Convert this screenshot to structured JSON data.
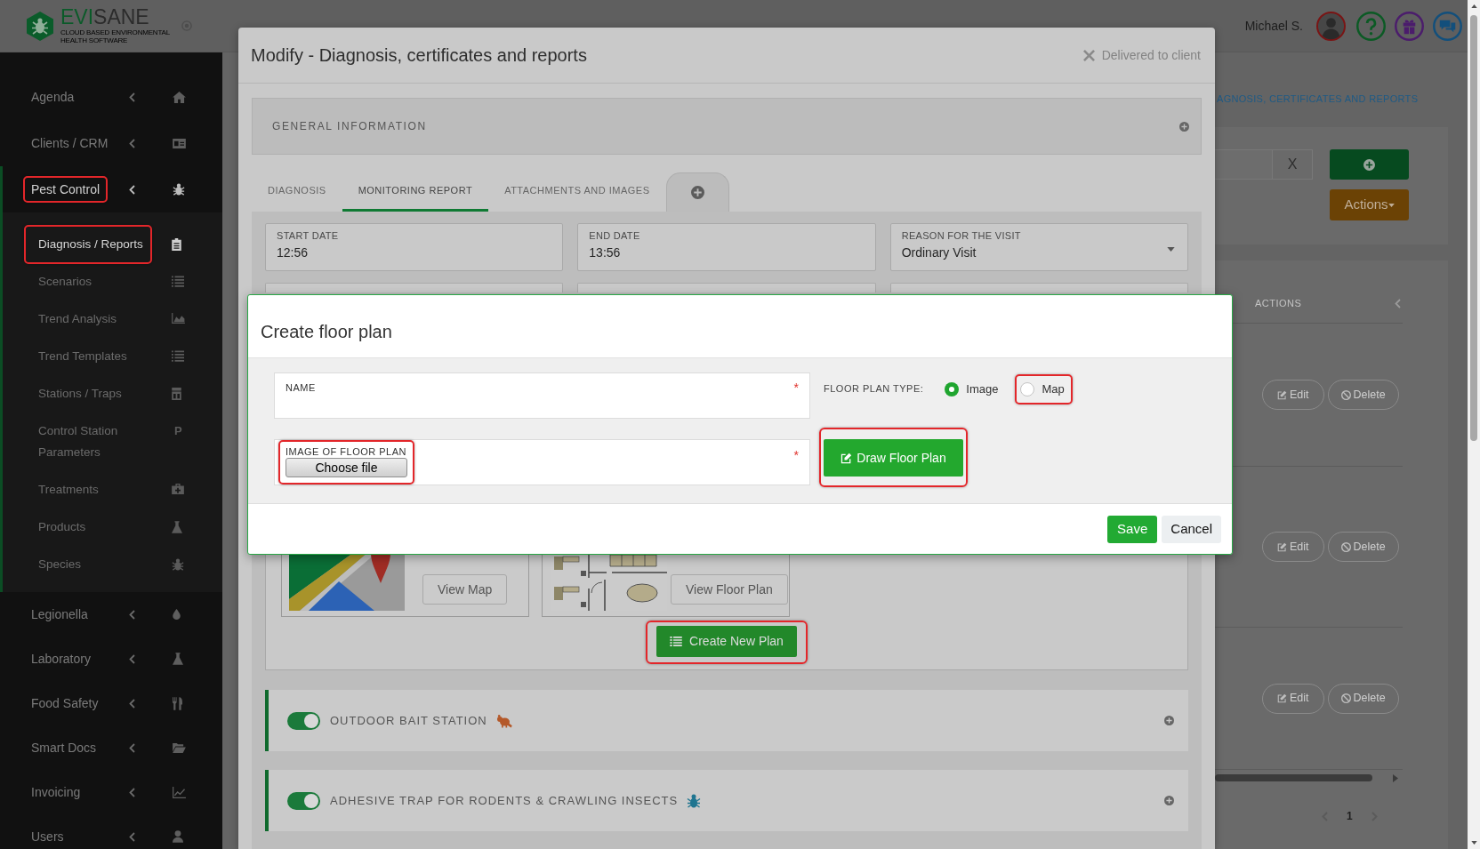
{
  "header": {
    "logo": "EVISANE",
    "tagline": "CLOUD BASED ENVIRONMENTAL HEALTH SOFTWARE",
    "user_name": "Michael S."
  },
  "sidebar": {
    "items": [
      {
        "label": "Agenda",
        "expanded": false,
        "highlighted": false
      },
      {
        "label": "Clients / CRM",
        "expanded": false,
        "highlighted": false
      },
      {
        "label": "Pest Control",
        "expanded": true,
        "highlighted": true,
        "children": [
          {
            "label": "Diagnosis / Reports",
            "selected": true,
            "highlighted": true
          },
          {
            "label": "Scenarios",
            "selected": false,
            "highlighted": false
          },
          {
            "label": "Trend Analysis",
            "selected": false,
            "highlighted": false
          },
          {
            "label": "Trend Templates",
            "selected": false,
            "highlighted": false
          },
          {
            "label": "Stations / Traps",
            "selected": false,
            "highlighted": false
          },
          {
            "label": "Control Station Parameters",
            "selected": false,
            "highlighted": false,
            "icon_letter": "P"
          },
          {
            "label": "Treatments",
            "selected": false,
            "highlighted": false
          },
          {
            "label": "Products",
            "selected": false,
            "highlighted": false
          },
          {
            "label": "Species",
            "selected": false,
            "highlighted": false
          }
        ]
      },
      {
        "label": "Legionella",
        "expanded": false,
        "highlighted": false
      },
      {
        "label": "Laboratory",
        "expanded": false,
        "highlighted": false
      },
      {
        "label": "Food Safety",
        "expanded": false,
        "highlighted": false
      },
      {
        "label": "Smart Docs",
        "expanded": false,
        "highlighted": false
      },
      {
        "label": "Invoicing",
        "expanded": false,
        "highlighted": false
      },
      {
        "label": "Users",
        "expanded": false,
        "highlighted": false
      }
    ]
  },
  "page": {
    "breadcrumb": "AGNOSIS, CERTIFICATES AND REPORTS",
    "clear_button": "X",
    "actions_button": "Actions",
    "table": {
      "columns": [
        "ACTIONS"
      ],
      "rows": [
        {
          "buttons": [
            {
              "label": "Edit",
              "kind": "edit"
            },
            {
              "label": "Delete",
              "kind": "delete"
            }
          ]
        },
        {
          "buttons": [
            {
              "label": "Edit",
              "kind": "edit"
            },
            {
              "label": "Delete",
              "kind": "delete"
            }
          ]
        },
        {
          "buttons": [
            {
              "label": "Edit",
              "kind": "edit"
            },
            {
              "label": "Delete",
              "kind": "delete"
            }
          ]
        }
      ]
    },
    "pagination": [
      {
        "label": "1",
        "selected": true
      }
    ]
  },
  "record_dialog": {
    "title": "Modify - Diagnosis, certificates and reports",
    "status": "Delivered to client",
    "section": "GENERAL INFORMATION",
    "tabs": [
      {
        "label": "DIAGNOSIS",
        "selected": false
      },
      {
        "label": "MONITORING REPORT",
        "selected": true
      },
      {
        "label": "ATTACHMENTS AND IMAGES",
        "selected": false
      }
    ],
    "fields": [
      {
        "label": "START DATE",
        "value": "12:56",
        "kind": "text"
      },
      {
        "label": "END DATE",
        "value": "13:56",
        "kind": "text"
      },
      {
        "label": "REASON FOR THE VISIT",
        "value": "Ordinary Visit",
        "kind": "select"
      }
    ],
    "plans": [
      {
        "kind": "map",
        "button": "View Map"
      },
      {
        "kind": "floor_plan",
        "button": "View Floor Plan"
      }
    ],
    "create_button": {
      "label": "Create New Plan",
      "highlighted": true
    },
    "station_groups": [
      {
        "label": "OUTDOOR BAIT STATION",
        "on": true
      },
      {
        "label": "ADHESIVE TRAP FOR RODENTS & CRAWLING INSECTS",
        "on": true
      }
    ]
  },
  "floor_plan_dialog": {
    "title": "Create floor plan",
    "name_field": {
      "label": "NAME",
      "required_mark": "*"
    },
    "type_label": "FLOOR PLAN TYPE:",
    "type_options": [
      {
        "label": "Image",
        "selected": true,
        "highlighted": false
      },
      {
        "label": "Map",
        "selected": false,
        "highlighted": true
      }
    ],
    "image_field": {
      "label": "IMAGE OF FLOOR PLAN",
      "required_mark": "*",
      "button": "Choose file",
      "highlighted": true
    },
    "draw_button": {
      "label": "Draw Floor Plan",
      "highlighted": true
    },
    "buttons": [
      {
        "label": "Save",
        "kind": "primary"
      },
      {
        "label": "Cancel",
        "kind": "secondary"
      }
    ]
  }
}
